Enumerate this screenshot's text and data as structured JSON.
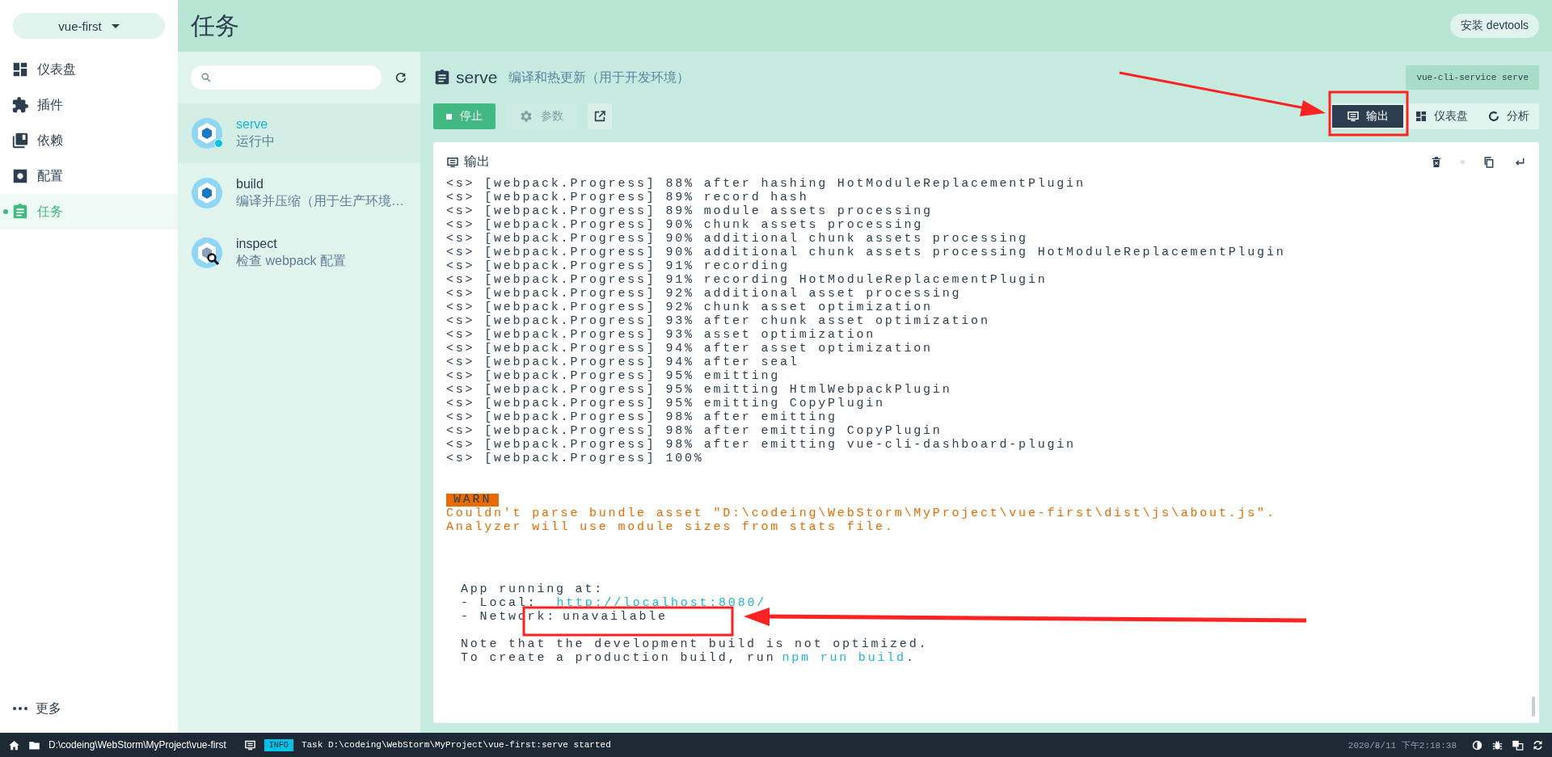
{
  "project_selector": {
    "label": "vue-first"
  },
  "nav": {
    "items": [
      {
        "label": "仪表盘",
        "kind": "dashboard",
        "selected": false
      },
      {
        "label": "插件",
        "kind": "plugins",
        "selected": false
      },
      {
        "label": "依赖",
        "kind": "dependencies",
        "selected": false
      },
      {
        "label": "配置",
        "kind": "config",
        "selected": false
      },
      {
        "label": "任务",
        "kind": "tasks",
        "selected": true
      }
    ],
    "more": "更多"
  },
  "header": {
    "title": "任务",
    "devtools_button": "安装 devtools"
  },
  "tasks": [
    {
      "name": "serve",
      "description": "运行中",
      "kind": "webpack",
      "running": true,
      "selected": true
    },
    {
      "name": "build",
      "description": "编译并压缩（用于生产环境…",
      "kind": "webpack",
      "running": false,
      "selected": false
    },
    {
      "name": "inspect",
      "description": "检查 webpack 配置",
      "kind": "inspect",
      "running": false,
      "selected": false
    }
  ],
  "detail": {
    "name": "serve",
    "description": "编译和热更新（用于开发环境）",
    "command": "vue-cli-service serve",
    "buttons": [
      {
        "label": "停止",
        "kind": "stop",
        "disabled": false
      },
      {
        "label": "参数",
        "kind": "params",
        "disabled": true
      },
      {
        "kind": "open",
        "disabled": false
      }
    ],
    "views": [
      {
        "label": "输出",
        "kind": "output",
        "selected": true
      },
      {
        "label": "仪表盘",
        "kind": "dashboard",
        "selected": false
      },
      {
        "label": "分析",
        "kind": "analyzer",
        "selected": false
      }
    ]
  },
  "output": {
    "title": "输出",
    "log": [
      "<s> [webpack.Progress] 88% after hashing HotModuleReplacementPlugin",
      "<s> [webpack.Progress] 89% record hash",
      "<s> [webpack.Progress] 89% module assets processing",
      "<s> [webpack.Progress] 90% chunk assets processing",
      "<s> [webpack.Progress] 90% additional chunk assets processing",
      "<s> [webpack.Progress] 90% additional chunk assets processing HotModuleReplacementPlugin",
      "<s> [webpack.Progress] 91% recording",
      "<s> [webpack.Progress] 91% recording HotModuleReplacementPlugin",
      "<s> [webpack.Progress] 92% additional asset processing",
      "<s> [webpack.Progress] 92% chunk asset optimization",
      "<s> [webpack.Progress] 93% after chunk asset optimization",
      "<s> [webpack.Progress] 93% asset optimization",
      "<s> [webpack.Progress] 94% after asset optimization",
      "<s> [webpack.Progress] 94% after seal",
      "<s> [webpack.Progress] 95% emitting",
      "<s> [webpack.Progress] 95% emitting HtmlWebpackPlugin",
      "<s> [webpack.Progress] 95% emitting CopyPlugin",
      "<s> [webpack.Progress] 98% after emitting",
      "<s> [webpack.Progress] 98% after emitting CopyPlugin",
      "<s> [webpack.Progress] 98% after emitting vue-cli-dashboard-plugin",
      "<s> [webpack.Progress] 100%"
    ],
    "warn": {
      "badge": "WARN",
      "lines": [
        "Couldn't parse bundle asset \"D:\\codeing\\WebStorm\\MyProject\\vue-first\\dist\\js\\about.js\".",
        "Analyzer will use module sizes from stats file."
      ]
    },
    "running": [
      [
        {
          "text": "App running at:",
          "kind": "plain"
        }
      ],
      [
        {
          "text": "- Local:",
          "kind": "plain"
        },
        {
          "text": "http://localhost:8080/",
          "kind": "link"
        }
      ],
      [
        {
          "text": "- Network:",
          "kind": "plain"
        },
        {
          "text": "unavailable",
          "kind": "plain"
        }
      ],
      [
        {
          "text": "Note that the development build is not optimized.",
          "kind": "plain"
        }
      ],
      [
        {
          "text": "To create a production build, run",
          "kind": "plain"
        },
        {
          "text": "npm run build",
          "kind": "link"
        },
        {
          "text": ".",
          "kind": "plain"
        }
      ]
    ]
  },
  "status_bar": {
    "path": "D:\\codeing\\WebStorm\\MyProject\\vue-first",
    "badge": "INFO",
    "message": "Task D:\\codeing\\WebStorm\\MyProject\\vue-first:serve started",
    "time": "2020/8/11 下午2:18:38"
  }
}
